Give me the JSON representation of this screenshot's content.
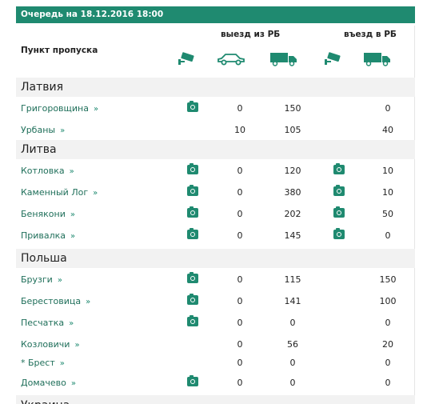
{
  "header": {
    "title": "Очередь на 18.12.2016 18:00"
  },
  "columns": {
    "checkpoint": "Пункт пропуска",
    "exit": "выезд из РБ",
    "entry": "въезд в РБ"
  },
  "icons": {
    "camera": "camera-icon",
    "car": "car-icon",
    "truck": "truck-icon"
  },
  "colors": {
    "accent": "#1f8a70"
  },
  "groups": [
    {
      "country": "Латвия",
      "rows": [
        {
          "name": "Григоровщина",
          "cam_out": true,
          "cars": "0",
          "trucks": "150",
          "cam_in": false,
          "in_trucks": "0"
        },
        {
          "name": "Урбаны",
          "cam_out": false,
          "cars": "10",
          "trucks": "105",
          "cam_in": false,
          "in_trucks": "40"
        }
      ]
    },
    {
      "country": "Литва",
      "rows": [
        {
          "name": "Котловка",
          "cam_out": true,
          "cars": "0",
          "trucks": "120",
          "cam_in": true,
          "in_trucks": "10"
        },
        {
          "name": "Каменный Лог",
          "cam_out": true,
          "cars": "0",
          "trucks": "380",
          "cam_in": true,
          "in_trucks": "10"
        },
        {
          "name": "Бенякони",
          "cam_out": true,
          "cars": "0",
          "trucks": "202",
          "cam_in": true,
          "in_trucks": "50"
        },
        {
          "name": "Привалка",
          "cam_out": true,
          "cars": "0",
          "trucks": "145",
          "cam_in": true,
          "in_trucks": "0"
        }
      ]
    },
    {
      "country": "Польша",
      "rows": [
        {
          "name": "Брузги",
          "cam_out": true,
          "cars": "0",
          "trucks": "115",
          "cam_in": false,
          "in_trucks": "150"
        },
        {
          "name": "Берестовица",
          "cam_out": true,
          "cars": "0",
          "trucks": "141",
          "cam_in": false,
          "in_trucks": "100"
        },
        {
          "name": "Песчатка",
          "cam_out": true,
          "cars": "0",
          "trucks": "0",
          "cam_in": false,
          "in_trucks": "0"
        },
        {
          "name": "Козловичи",
          "cam_out": false,
          "cars": "0",
          "trucks": "56",
          "cam_in": false,
          "in_trucks": "20"
        },
        {
          "name": "* Брест",
          "cam_out": false,
          "cars": "0",
          "trucks": "0",
          "cam_in": false,
          "in_trucks": "0"
        },
        {
          "name": "Домачево",
          "cam_out": true,
          "cars": "0",
          "trucks": "0",
          "cam_in": false,
          "in_trucks": "0"
        }
      ]
    },
    {
      "country": "Украина",
      "rows": []
    }
  ],
  "chevron": "»"
}
